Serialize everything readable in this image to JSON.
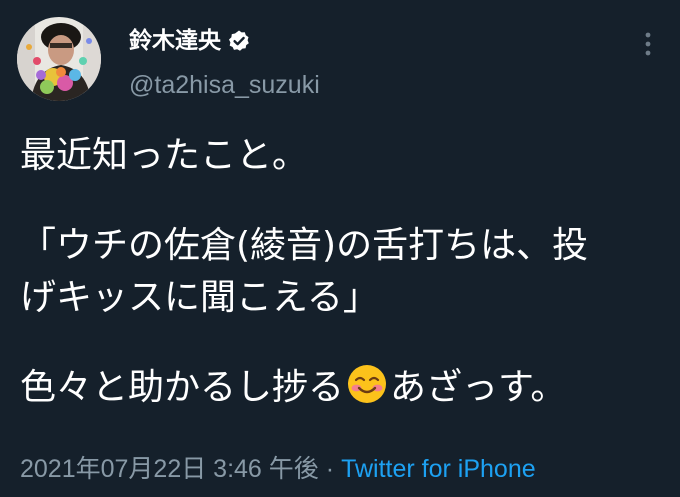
{
  "author": {
    "display_name": "鈴木達央",
    "handle": "@ta2hisa_suzuki",
    "verified": true,
    "avatar_icon": "profile-photo"
  },
  "tweet": {
    "line1": "最近知ったこと。",
    "line2": "「ウチの佐倉(綾音)の舌打ちは、投",
    "line3": "げキッスに聞こえる」",
    "line4_before": "色々と助かるし捗る",
    "line4_emoji": "smiling-face-with-blush-emoji",
    "line4_after": "あざっす。"
  },
  "meta": {
    "timestamp": "2021年07月22日 3:46 午後",
    "separator": "·",
    "source": "Twitter for iPhone"
  },
  "colors": {
    "background": "#15202b",
    "text_primary": "#ffffff",
    "text_secondary": "#8899a6",
    "accent": "#1da1f2"
  }
}
